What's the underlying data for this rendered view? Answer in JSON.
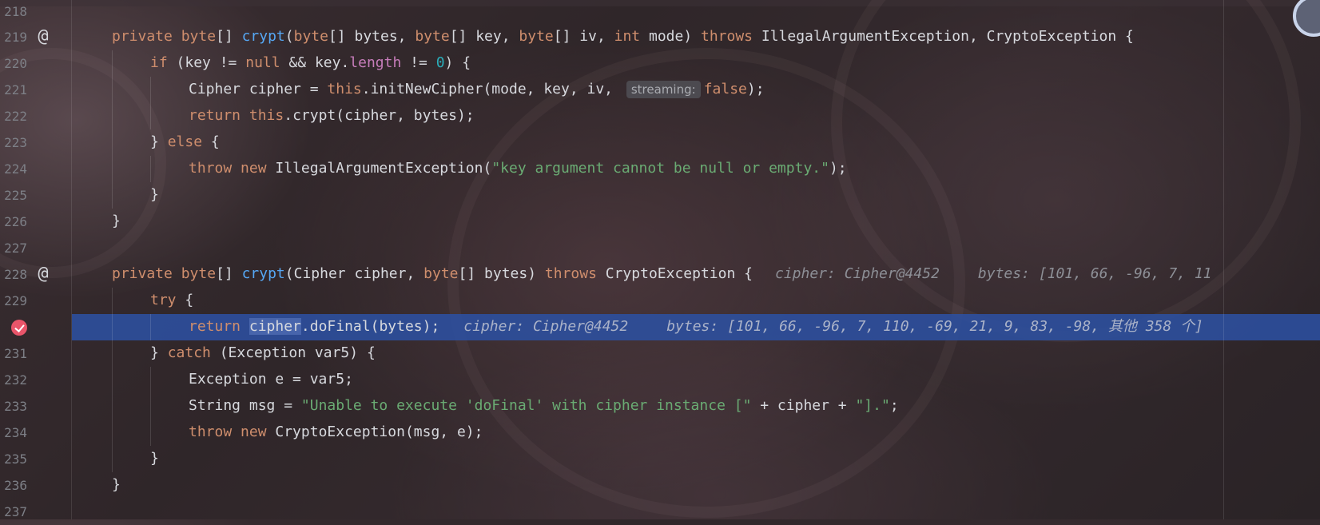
{
  "editor": {
    "lines": [
      {
        "num": "218",
        "marker": ""
      },
      {
        "num": "219",
        "marker": "at"
      },
      {
        "num": "220",
        "marker": ""
      },
      {
        "num": "221",
        "marker": ""
      },
      {
        "num": "222",
        "marker": ""
      },
      {
        "num": "223",
        "marker": ""
      },
      {
        "num": "224",
        "marker": ""
      },
      {
        "num": "225",
        "marker": ""
      },
      {
        "num": "226",
        "marker": ""
      },
      {
        "num": "227",
        "marker": ""
      },
      {
        "num": "228",
        "marker": "at"
      },
      {
        "num": "229",
        "marker": ""
      },
      {
        "num": "",
        "marker": "breakpoint"
      },
      {
        "num": "231",
        "marker": ""
      },
      {
        "num": "232",
        "marker": ""
      },
      {
        "num": "233",
        "marker": ""
      },
      {
        "num": "234",
        "marker": ""
      },
      {
        "num": "235",
        "marker": ""
      },
      {
        "num": "236",
        "marker": ""
      },
      {
        "num": "237",
        "marker": ""
      }
    ],
    "code": {
      "l219": {
        "private": "private",
        "byte1": "byte",
        "br1": "[] ",
        "crypt": "crypt",
        "p1": "(",
        "byte2": "byte",
        "t2": "[] bytes, ",
        "byte3": "byte",
        "t3": "[] key, ",
        "byte4": "byte",
        "t4": "[] iv, ",
        "int": "int",
        "t5": " mode) ",
        "throws": "throws",
        "t6": " IllegalArgumentException, CryptoException {"
      },
      "l220": {
        "if": "if",
        "t1": " (key != ",
        "null": "null",
        "t2": " && key.",
        "length": "length",
        "t3": " != ",
        "zero": "0",
        "t4": ") {"
      },
      "l221": {
        "t1": "Cipher cipher = ",
        "this": "this",
        "t2": ".initNewCipher(mode, key, iv, ",
        "hint": "streaming:",
        "false": "false",
        "t3": ");"
      },
      "l222": {
        "return": "return",
        "sp": " ",
        "this": "this",
        "t1": ".crypt(cipher, bytes);"
      },
      "l223": {
        "t1": "} ",
        "else": "else",
        "t2": " {"
      },
      "l224": {
        "throw": "throw",
        "sp": " ",
        "new": "new",
        "t1": " IllegalArgumentException(",
        "str": "\"key argument cannot be null or empty.\"",
        "t2": ");"
      },
      "l225": {
        "t1": "}"
      },
      "l226": {
        "t1": "}"
      },
      "l228": {
        "private": "private",
        "byte1": "byte",
        "t1": "[] ",
        "crypt": "crypt",
        "t2": "(Cipher cipher, ",
        "byte2": "byte",
        "t3": "[] bytes) ",
        "throws": "throws",
        "t4": " CryptoException {",
        "inlay1": "cipher: Cipher@4452",
        "inlay2": "bytes: [101, 66, -96, 7, 11"
      },
      "l229": {
        "try": "try",
        "t1": " {"
      },
      "l230": {
        "return": "return",
        "t0": " ",
        "cipher": "cipher",
        "t1": ".doFinal(bytes);",
        "inlay1": "cipher: Cipher@4452",
        "inlay2": "bytes: [101, 66, -96, 7, 110, -69, 21, 9, 83, -98, 其他 358 个]"
      },
      "l231": {
        "t1": "} ",
        "catch": "catch",
        "t2": " (Exception var5) {"
      },
      "l232": {
        "t1": "Exception e = var5;"
      },
      "l233": {
        "t1": "String msg = ",
        "s1": "\"Unable to execute 'doFinal' with cipher instance [\"",
        "t2": " + cipher + ",
        "s2": "\"].\"",
        "t3": ";"
      },
      "l234": {
        "throw": "throw",
        "sp": " ",
        "new": "new",
        "t1": " CryptoException(msg, e);"
      },
      "l235": {
        "t1": "}"
      },
      "l236": {
        "t1": "}"
      }
    }
  },
  "colors": {
    "keyword": "#cf8e6d",
    "function": "#56a8f5",
    "field": "#c77dbb",
    "number": "#2aacb8",
    "string": "#6aab73",
    "current_line": "#2c50a0",
    "breakpoint": "#e9556a"
  },
  "icons": {
    "override": "at-sign-icon",
    "breakpoint": "breakpoint-check-icon"
  }
}
